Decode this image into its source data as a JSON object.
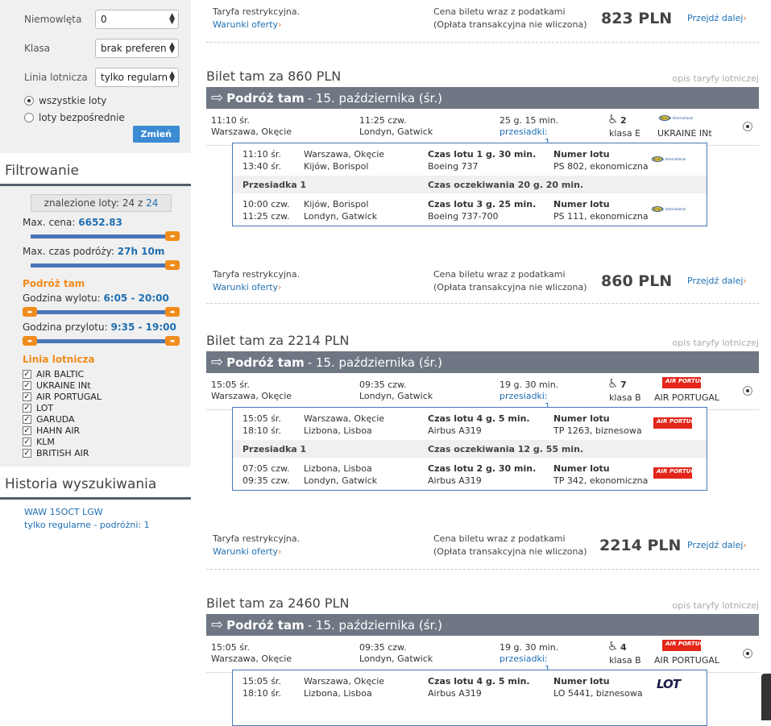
{
  "sidebar": {
    "form": {
      "infants_label": "Niemowlęta",
      "infants_value": "0",
      "class_label": "Klasa",
      "class_value": "brak preferen",
      "airline_label": "Linia lotnicza",
      "airline_value": "tylko regularn",
      "radio_all": "wszystkie loty",
      "radio_direct": "loty bezpośrednie",
      "change_button": "Zmień"
    },
    "filter": {
      "heading": "Filtrowanie",
      "found_prefix": "znalezione loty: 24 z",
      "found_total": "24",
      "max_price_label": "Max. cena:",
      "max_price_value": "6652.83",
      "max_time_label": "Max. czas podróży:",
      "max_time_value": "27h 10m",
      "outbound_heading": "Podróż tam",
      "dep_time_label": "Godzina wylotu:",
      "dep_time_value": "6:05 - 20:00",
      "arr_time_label": "Godzina przylotu:",
      "arr_time_value": "9:35 - 19:00",
      "airlines_heading": "Linia lotnicza",
      "airlines": [
        "AIR BALTIC",
        "UKRAINE INt",
        "AIR PORTUGAL",
        "LOT",
        "GARUDA",
        "HAHN AIR",
        "KLM",
        "BRITISH AIR"
      ]
    },
    "history": {
      "heading": "Historia wyszukiwania",
      "line1": "WAW 15OCT LGW",
      "line2": "tylko regularne - podróżni: 1"
    }
  },
  "common": {
    "fare_restrict": "Taryfa restrykcyjna.",
    "offer_terms": "Warunki oferty",
    "price_note1": "Cena biletu wraz z podatkami",
    "price_note2": "(Opłata transakcyjna nie wliczona)",
    "proceed": "Przejdź dalej",
    "fare_desc": "opis taryfy lotniczej",
    "trip_label": "Podróż tam",
    "trip_date": "- 15. października (śr.)",
    "transfers": "przesiadki",
    "transfer_word": "Przesiadka 1",
    "flight_no_label": "Numer lotu"
  },
  "top": {
    "price": "823 PLN"
  },
  "tickets": [
    {
      "title": "Bilet tam za 860 PLN",
      "price": "860 PLN",
      "dep_time": "11:10 śr.",
      "dep_city": "Warszawa, Okęcie",
      "arr_time": "11:25 czw.",
      "arr_city": "Londyn, Gatwick",
      "duration": "25 g. 15 min.",
      "transfers_count": ": 1",
      "seats": "2",
      "class": "klasa E",
      "airline": "UKRAINE INt",
      "segments": [
        {
          "t1": "11:10 śr.",
          "t2": "13:40 śr.",
          "c1": "Warszawa, Okęcie",
          "c2": "Kijów, Borispol",
          "dur": "Czas lotu 1 g. 30 min.",
          "plane": "Boeing 737",
          "fno": "PS 802, ekonomiczna"
        },
        {
          "t1": "10:00 czw.",
          "t2": "11:25 czw.",
          "c1": "Kijów, Borispol",
          "c2": "Londyn, Gatwick",
          "dur": "Czas lotu 3 g. 25 min.",
          "plane": "Boeing 737-700",
          "fno": "PS 111, ekonomiczna"
        }
      ],
      "wait": "Czas oczekiwania 20 g. 20 min."
    },
    {
      "title": "Bilet tam za 2214 PLN",
      "price": "2214 PLN",
      "dep_time": "15:05 śr.",
      "dep_city": "Warszawa, Okęcie",
      "arr_time": "09:35 czw.",
      "arr_city": "Londyn, Gatwick",
      "duration": "19 g. 30 min.",
      "transfers_count": ": 1",
      "seats": "7",
      "class": "klasa B",
      "airline": "AIR PORTUGAL",
      "segments": [
        {
          "t1": "15:05 śr.",
          "t2": "18:10 śr.",
          "c1": "Warszawa, Okęcie",
          "c2": "Lizbona, Lisboa",
          "dur": "Czas lotu 4 g. 5 min.",
          "plane": "Airbus A319",
          "fno": "TP 1263, biznesowa"
        },
        {
          "t1": "07:05 czw.",
          "t2": "09:35 czw.",
          "c1": "Lizbona, Lisboa",
          "c2": "Londyn, Gatwick",
          "dur": "Czas lotu 2 g. 30 min.",
          "plane": "Airbus A319",
          "fno": "TP 342, ekonomiczna"
        }
      ],
      "wait": "Czas oczekiwania 12 g. 55 min."
    },
    {
      "title": "Bilet tam za 2460 PLN",
      "dep_time": "15:05 śr.",
      "dep_city": "Warszawa, Okęcie",
      "arr_time": "09:35 czw.",
      "arr_city": "Londyn, Gatwick",
      "duration": "19 g. 30 min.",
      "transfers_count": ": 1",
      "seats": "4",
      "class": "klasa B",
      "airline": "AIR PORTUGAL",
      "segments": [
        {
          "t1": "15:05 śr.",
          "t2": "18:10 śr.",
          "c1": "Warszawa, Okęcie",
          "c2": "Lizbona, Lisboa",
          "dur": "Czas lotu 4 g. 5 min.",
          "plane": "Airbus A319",
          "fno": "LO 5441, biznesowa"
        }
      ]
    }
  ],
  "logos": {
    "uia": "Ukraine International",
    "tap": "AIR PORTUGAL",
    "lot": "LOT"
  },
  "colors": {
    "accent": "#1f6fb2",
    "orange": "#f08c1c",
    "bar": "#6e7783",
    "border": "#4a76b8"
  }
}
